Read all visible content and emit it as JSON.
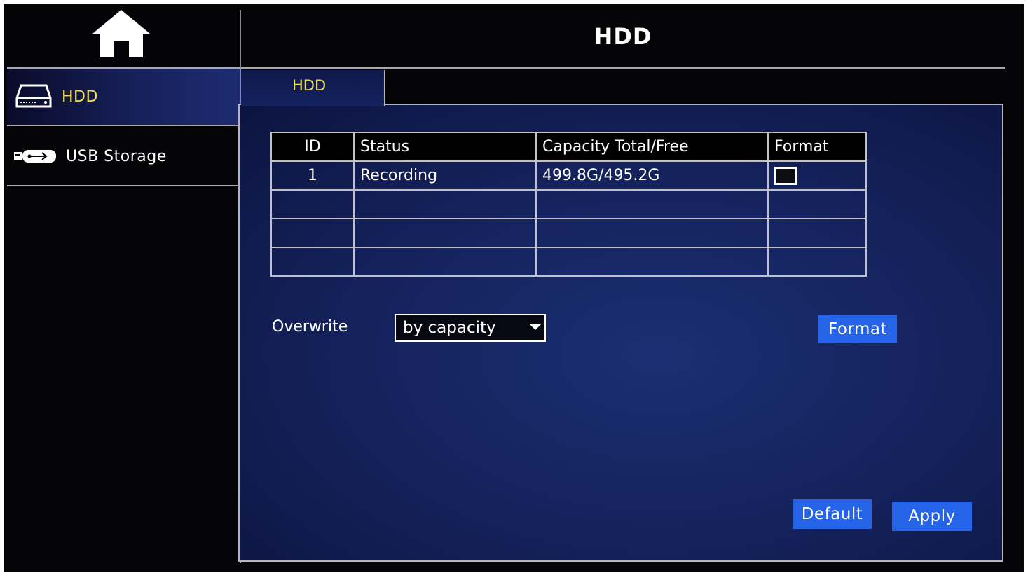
{
  "window": {
    "title": "HDD"
  },
  "sidebar": {
    "home_icon": "home-icon",
    "items": [
      {
        "label": "HDD",
        "icon": "hdd-icon",
        "active": true
      },
      {
        "label": "USB Storage",
        "icon": "usb-icon",
        "active": false
      }
    ]
  },
  "tabs": [
    {
      "label": "HDD",
      "active": true
    }
  ],
  "table": {
    "headers": [
      "ID",
      "Status",
      "Capacity Total/Free",
      "Format"
    ],
    "rows": [
      {
        "id": "1",
        "status": "Recording",
        "capacity": "499.8G/495.2G",
        "format_checked": false
      }
    ]
  },
  "overwrite": {
    "label": "Overwrite",
    "value": "by capacity"
  },
  "buttons": {
    "format": "Format",
    "default": "Default",
    "apply": "Apply"
  },
  "colors": {
    "accent": "#2563e8",
    "active_text": "#f2e04a",
    "panel": "#14215a"
  }
}
